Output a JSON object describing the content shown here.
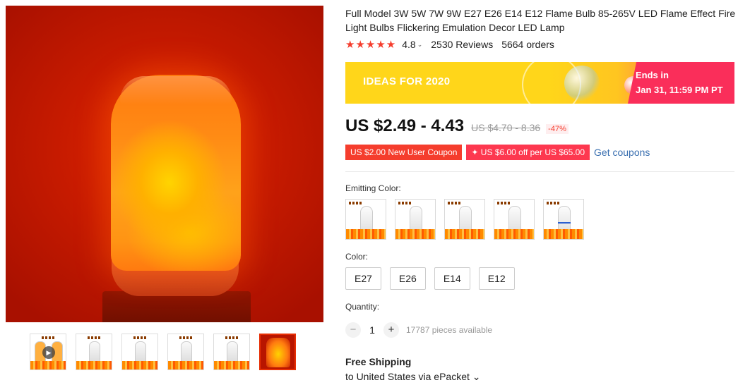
{
  "product": {
    "title": "Full Model 3W 5W 7W 9W E27 E26 E14 E12 Flame Bulb 85-265V LED Flame Effect Fire Light Bulbs Flickering Emulation Decor LED Lamp",
    "stars": "★★★★★",
    "rating": "4.8",
    "reviews": "2530 Reviews",
    "orders": "5664 orders"
  },
  "banner": {
    "title": "IDEAS FOR 2020",
    "ends_label": "Ends in",
    "ends_date": "Jan 31, 11:59 PM PT"
  },
  "price": {
    "current": "US $2.49 - 4.43",
    "original": "US $4.70 - 8.36",
    "discount": "-47%"
  },
  "coupons": {
    "new_user": "US $2.00 New User Coupon",
    "store": "✦ US $6.00 off per US $65.00",
    "get_link": "Get coupons"
  },
  "emitting_color": {
    "label": "Emitting Color:"
  },
  "color": {
    "label": "Color:",
    "options": [
      "E27",
      "E26",
      "E14",
      "E12"
    ]
  },
  "quantity": {
    "label": "Quantity:",
    "minus": "−",
    "value": "1",
    "plus": "+",
    "available": "17787 pieces available"
  },
  "shipping": {
    "title": "Free Shipping",
    "detail": "to United States via ePacket ⌄"
  },
  "icons": {
    "play": "▶",
    "chevron": "⌄"
  },
  "colors": {
    "accent_red": "#f53d2d",
    "banner_yellow": "#ffd61a",
    "banner_pink": "#fa2e5a",
    "link_blue": "#3a6fb0"
  }
}
